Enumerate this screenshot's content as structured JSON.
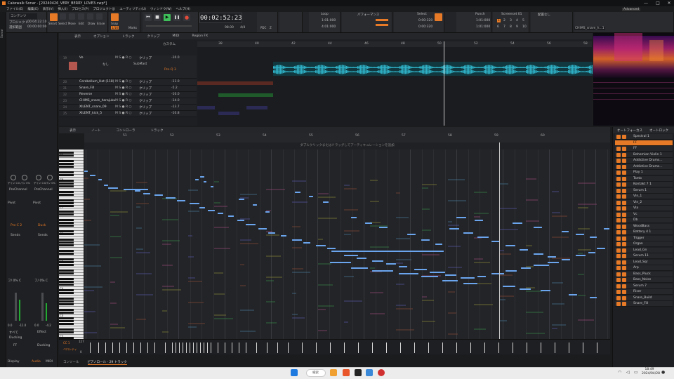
{
  "window": {
    "title": "Cakewalk Sonar - [20240426_VERY_BERRY_LOVE3.cwp*]",
    "controls": [
      "—",
      "□",
      "✕"
    ]
  },
  "menu": [
    "ファイル(E)",
    "編集(E)",
    "表示(V)",
    "挿入(I)",
    "プロセス(P)",
    "プロジェクト(J)",
    "ユーティリティ(U)",
    "ウィンドウ(W)",
    "ヘルプ(H)"
  ],
  "leftstrip": {
    "label": "Sonar"
  },
  "controlbar": {
    "workspace": "コンテンツ",
    "project_labels": [
      "プロジェクト",
      "選択範囲"
    ],
    "project_times": [
      "00:04:22:10",
      "00:00:00:00"
    ],
    "tools": [
      "Smart",
      "Select",
      "Move",
      "Edit",
      "Draw",
      "Erase"
    ],
    "snap_label": "Snap",
    "snap_value": "1/16",
    "marks_label": "Marks",
    "time": "00:02:52:23",
    "tempo": "98.00",
    "meter": "4/4",
    "loop_label": "Loop",
    "loop_times": [
      "1:01:000",
      "4:01:000"
    ],
    "perf_label": "パフォーマンス",
    "select_label": "Select",
    "select_times": [
      "0:00:320",
      "0:00:320"
    ],
    "punch_label": "Punch",
    "punch_times": [
      "1:01:000",
      "1:01:000"
    ],
    "screenset_label": "Screenset 01",
    "screenset_numbers": [
      "1",
      "2",
      "3",
      "4",
      "5",
      "6",
      "7",
      "8",
      "9",
      "10"
    ],
    "arranger_label": "配置なし",
    "advanced_label": "Advanced",
    "track_box": "CHIMS_snare_h...1",
    "pdc_label": "PDC",
    "zero_label": "Z",
    "rewind_icon": "rewind-icon",
    "play_icon": "play-icon",
    "record_icon": "record-icon"
  },
  "trackview": {
    "menu": [
      "表示",
      "オプション",
      "トラック",
      "クリップ",
      "MIDI",
      "Region FX"
    ],
    "custom_label": "カスタム",
    "ruler_marks": [
      "38",
      "40",
      "42",
      "44",
      "46",
      "48",
      "50",
      "52",
      "54",
      "56",
      "58"
    ],
    "tracks": [
      {
        "num": "19",
        "name": "Vo",
        "val": "-10.0",
        "clip": "クリップ"
      },
      {
        "num": "20",
        "name": "Cerebellum_Hat (118)",
        "val": "-11.0",
        "clip": "クリップ"
      },
      {
        "num": "21",
        "name": "Snare_Fill",
        "val": "-5.2",
        "clip": "クリップ"
      },
      {
        "num": "22",
        "name": "Reverse",
        "val": "-10.0",
        "clip": "クリップ"
      },
      {
        "num": "23",
        "name": "CHIMS_snare_harajuku",
        "val": "-14.0",
        "clip": "クリップ"
      },
      {
        "num": "24",
        "name": "XILENT_snare_09",
        "val": "-13.7",
        "clip": "クリップ"
      },
      {
        "num": "25",
        "name": "XILENT_kick_5",
        "val": "-10.8",
        "clip": "クリップ"
      }
    ],
    "vo_controls": {
      "lane": "なし",
      "output": "SubMast",
      "region": "Pro-Q 3"
    },
    "ms_labels": "M S ● R ○"
  },
  "pianoroll": {
    "menu": [
      "表示",
      "ノート",
      "コントローラ",
      "トラック"
    ],
    "hint": "ダブルクリックまたはドラッグしてアーティキュレーションを追加",
    "ruler_marks": [
      "51",
      "52",
      "53",
      "54",
      "55",
      "56",
      "57",
      "58",
      "59",
      "60"
    ],
    "octave_labels": [
      "C9",
      "C8",
      "C7",
      "C6",
      "C5",
      "C4",
      "C3",
      "C2"
    ],
    "lane_labels": [
      "CC 1",
      "ベロシティ"
    ],
    "vel_top": "127",
    "vel_bottom": "0"
  },
  "inspector": {
    "knob_labels": [
      "ゲイン 0.0",
      "パン 0%",
      "ゲイン 0.0",
      "パン 0%"
    ],
    "channel": "ProChannel",
    "io": [
      "Pivot",
      "Pivot"
    ],
    "fx": [
      "Pro-C 2",
      "Duck"
    ],
    "sends_label": "Sends",
    "vol_labels": [
      "0.0",
      "-11.0",
      "0.0",
      "-4.2"
    ],
    "pan_labels": [
      "フ/ 0% C",
      "フ/ 0% C"
    ],
    "bottom_buttons": [
      "すべて",
      "Effect"
    ],
    "bus_names": [
      "Ducking",
      "Ducking"
    ],
    "bus_left": "FF",
    "tabs": [
      "Display",
      "Audio",
      "MIDI"
    ]
  },
  "automation": {
    "tabs": [
      "オートフォーカス",
      "オートロック"
    ],
    "items": [
      "Spectral 1",
      "FF",
      "FF",
      "Bohemian Violin 1",
      "Addictive Drums...",
      "Addictive Drums...",
      "Play 1",
      "Tamb",
      "Kontakt 7 1",
      "Serum 1",
      "Vln_1",
      "Vln_2",
      "Vla",
      "Vc",
      "Db",
      "WoodBass",
      "Battery 4 1",
      "Trigger",
      "Organ",
      "Lead_Gn",
      "Serum 11",
      "Lead_Sqr",
      "Arp",
      "Bass_Pluck",
      "Bass_Noise",
      "Serum 7",
      "Riser",
      "Snare_Build",
      "Snare_Fill"
    ]
  },
  "bottomtabs": [
    "コンソール",
    "ピアノロール - 29 トラック"
  ],
  "taskbar": {
    "search": "検索",
    "time": "18:49",
    "date": "2024/04/28"
  },
  "colors": {
    "accent": "#e77a26",
    "note": "#6ba5ee",
    "waveform": "#2fb0c5",
    "play": "#3fbf5a",
    "record": "#e24a3a"
  }
}
